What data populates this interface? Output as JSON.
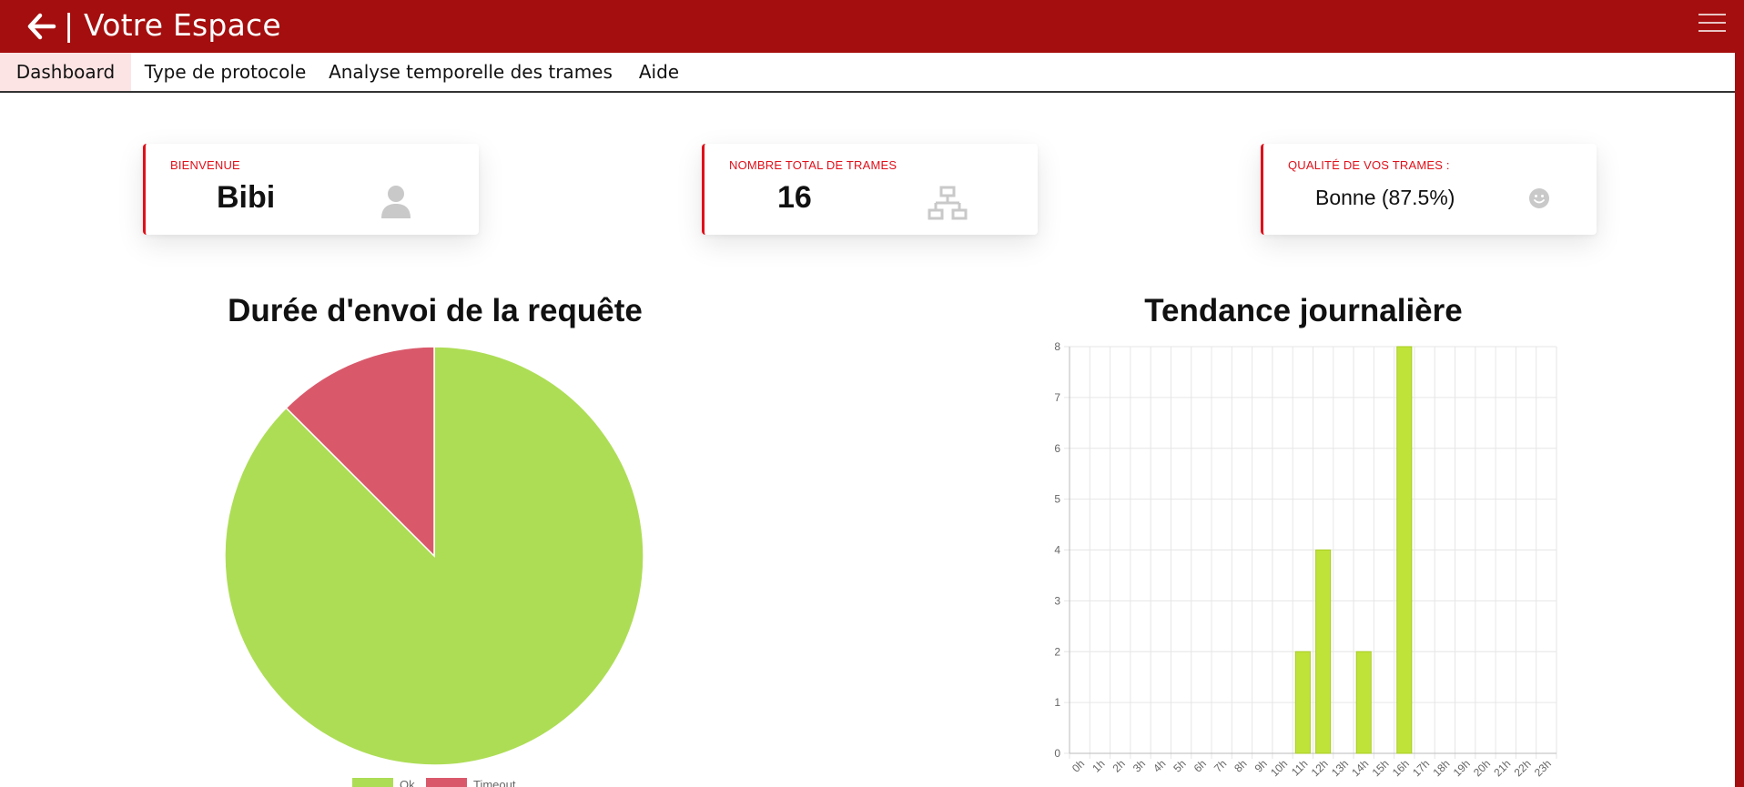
{
  "header": {
    "title": "| Votre Espace",
    "background_color": "#a50e0e"
  },
  "nav": {
    "tabs": [
      {
        "label": "Dashboard",
        "active": true
      },
      {
        "label": "Type de protocole",
        "active": false
      },
      {
        "label": "Analyse temporelle des trames",
        "active": false
      },
      {
        "label": "Aide",
        "active": false
      }
    ]
  },
  "cards": {
    "welcome": {
      "label": "BIENVENUE",
      "value": "Bibi",
      "icon": "user-icon"
    },
    "total": {
      "label": "NOMBRE TOTAL DE TRAMES",
      "value": "16",
      "icon": "network-icon"
    },
    "quality": {
      "label": "QUALITÉ DE VOS TRAMES :",
      "value": "Bonne (87.5%)",
      "icon": "smiley-icon"
    },
    "accent_color": "#e0101a"
  },
  "chart_data": [
    {
      "type": "pie",
      "title": "Durée d'envoi de la requête",
      "categories": [
        "Ok",
        "Timeout"
      ],
      "values": [
        14,
        2
      ],
      "colors": [
        "#addd55",
        "#d9596b"
      ],
      "legend": "bottom"
    },
    {
      "type": "bar",
      "title": "Tendance journalière",
      "categories": [
        "0h",
        "1h",
        "2h",
        "3h",
        "4h",
        "5h",
        "6h",
        "7h",
        "8h",
        "9h",
        "10h",
        "11h",
        "12h",
        "13h",
        "14h",
        "15h",
        "16h",
        "17h",
        "18h",
        "19h",
        "20h",
        "21h",
        "22h",
        "23h"
      ],
      "values": [
        0,
        0,
        0,
        0,
        0,
        0,
        0,
        0,
        0,
        0,
        0,
        2,
        4,
        0,
        2,
        0,
        8,
        0,
        0,
        0,
        0,
        0,
        0,
        0
      ],
      "ylim": [
        0,
        8
      ],
      "yticks": [
        0,
        1,
        2,
        3,
        4,
        5,
        6,
        7,
        8
      ],
      "grid": true,
      "bar_color": "#c0e33a"
    }
  ]
}
